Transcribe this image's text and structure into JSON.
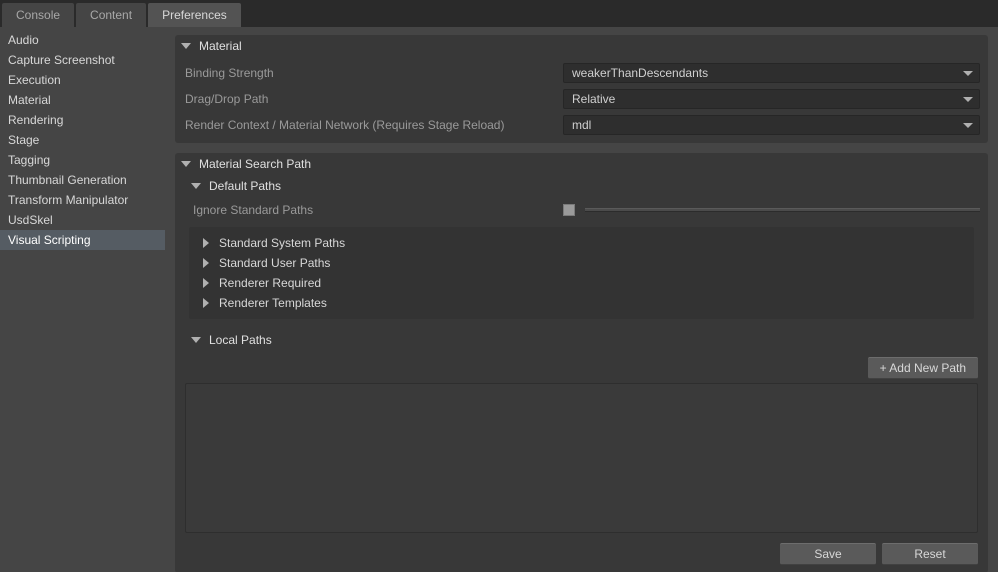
{
  "tabs": [
    "Console",
    "Content",
    "Preferences"
  ],
  "sidebar": {
    "items": [
      "Audio",
      "Capture Screenshot",
      "Execution",
      "Material",
      "Rendering",
      "Stage",
      "Tagging",
      "Thumbnail Generation",
      "Transform Manipulator",
      "UsdSkel",
      "Visual Scripting"
    ]
  },
  "material_panel": {
    "title": "Material",
    "binding_strength_label": "Binding Strength",
    "binding_strength_value": "weakerThanDescendants",
    "drag_drop_label": "Drag/Drop Path",
    "drag_drop_value": "Relative",
    "render_context_label": "Render Context / Material Network (Requires Stage Reload)",
    "render_context_value": "mdl"
  },
  "search_panel": {
    "title": "Material Search Path",
    "default_title": "Default Paths",
    "ignore_label": "Ignore Standard Paths",
    "folds": [
      "Standard System Paths",
      "Standard User Paths",
      "Renderer Required",
      "Renderer Templates"
    ],
    "local_title": "Local Paths",
    "add_btn": "+ Add New Path"
  },
  "buttons": {
    "save": "Save",
    "reset": "Reset"
  }
}
